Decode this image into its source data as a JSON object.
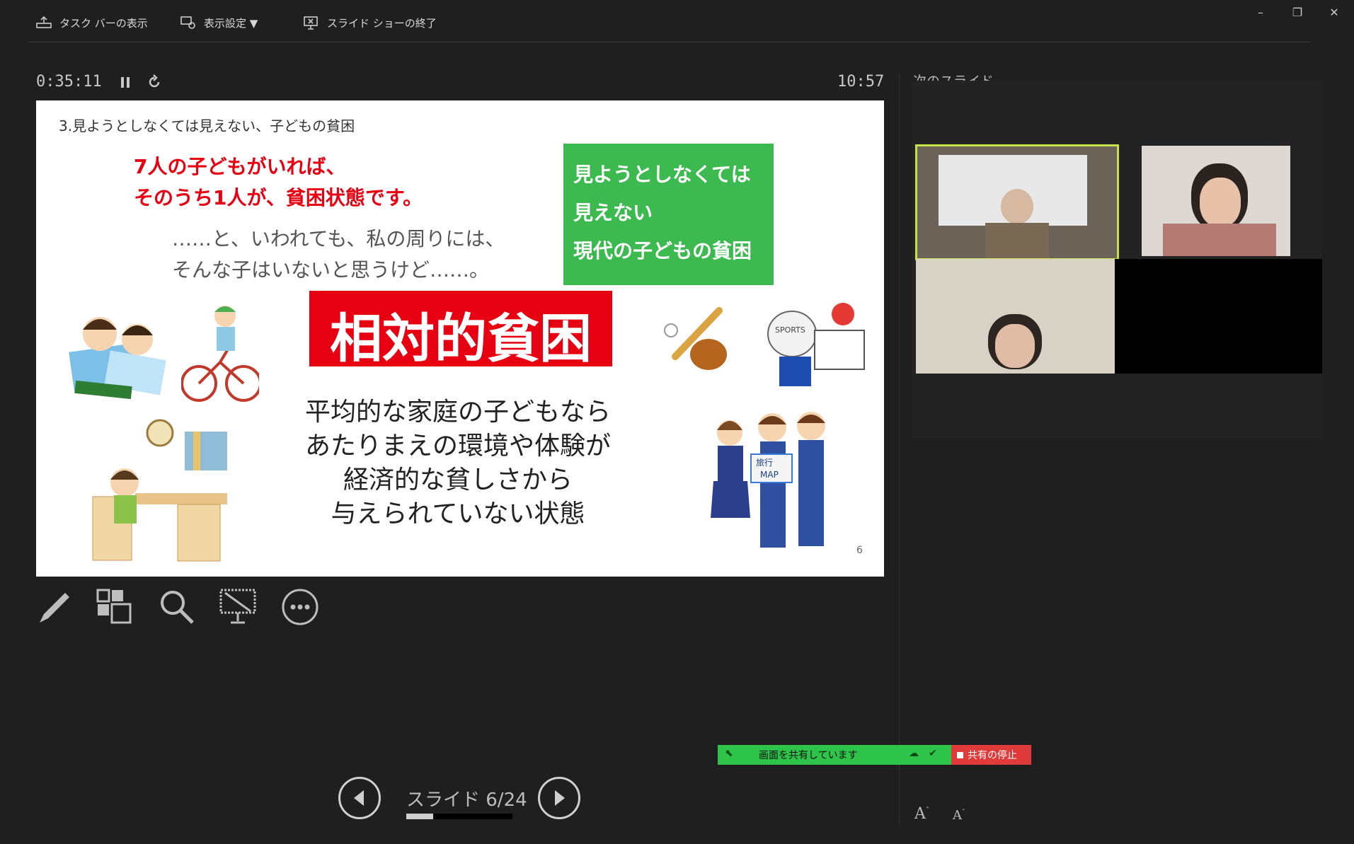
{
  "toolbar": {
    "taskbar_label": "タスク バーの表示",
    "display_settings_label": "表示設定 ▼",
    "end_show_label": "スライド ショーの終了"
  },
  "window": {
    "minimize": "–",
    "restore": "❐",
    "close": "✕"
  },
  "presenter": {
    "elapsed": "0:35:11",
    "clock": "10:57",
    "next_slide_label": "次のスライド",
    "slide_counter": "スライド 6/24",
    "progress_fraction": 0.25
  },
  "slide": {
    "title": "3.見ようとしなくては見えない、子どもの貧困",
    "red_line1": "7人の子どもがいれば、",
    "red_line2": "そのうち1人が、貧困状態です。",
    "gray_line1": "……と、いわれても、私の周りには、",
    "gray_line2": "そんな子はいないと思うけど……。",
    "green_box_line1": "見ようとしなくては",
    "green_box_line2": "見えない",
    "green_box_line3": "現代の子どもの貧困",
    "banner": "相対的貧困",
    "body_line1": "平均的な家庭の子どもなら",
    "body_line2": "あたりまえの環境や体験が",
    "body_line3": "経済的な貧しさから",
    "body_line4": "与えられていない状態",
    "page_number": "6",
    "map_label_1": "旅行",
    "map_label_2": "MAP",
    "bag_label": "SPORTS"
  },
  "share": {
    "sharing_text": "画面を共有しています",
    "stop_text": "共有の停止"
  },
  "font_controls": {
    "increase": "A",
    "decrease": "A"
  },
  "colors": {
    "accent_green": "#2ec44a",
    "stop_red": "#e03a3a",
    "slide_red": "#e60012",
    "slide_green": "#3cba4f"
  }
}
